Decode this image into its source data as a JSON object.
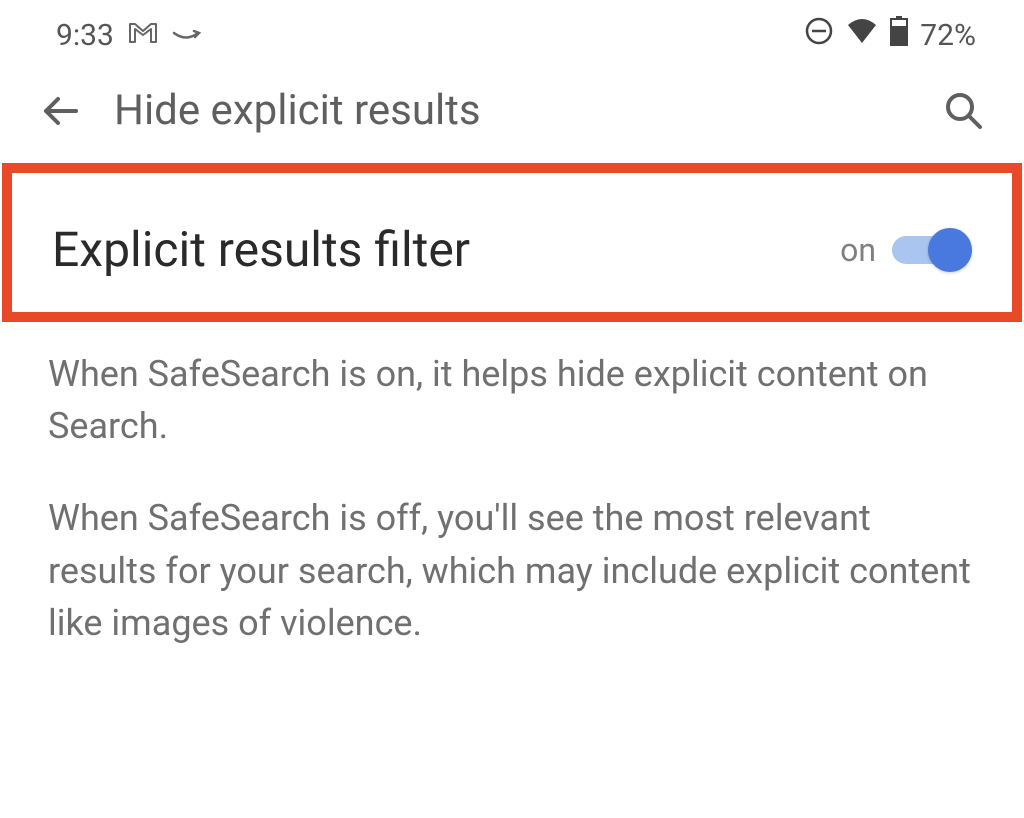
{
  "status_bar": {
    "time": "9:33",
    "battery_percentage": "72%"
  },
  "app_bar": {
    "title": "Hide explicit results"
  },
  "setting": {
    "title": "Explicit results filter",
    "toggle_state": "on"
  },
  "description": {
    "paragraph1": "When SafeSearch is on, it helps hide explicit content on Search.",
    "paragraph2": "When SafeSearch is off, you'll see the most relevant results for your search, which may include explicit content like images of violence."
  }
}
